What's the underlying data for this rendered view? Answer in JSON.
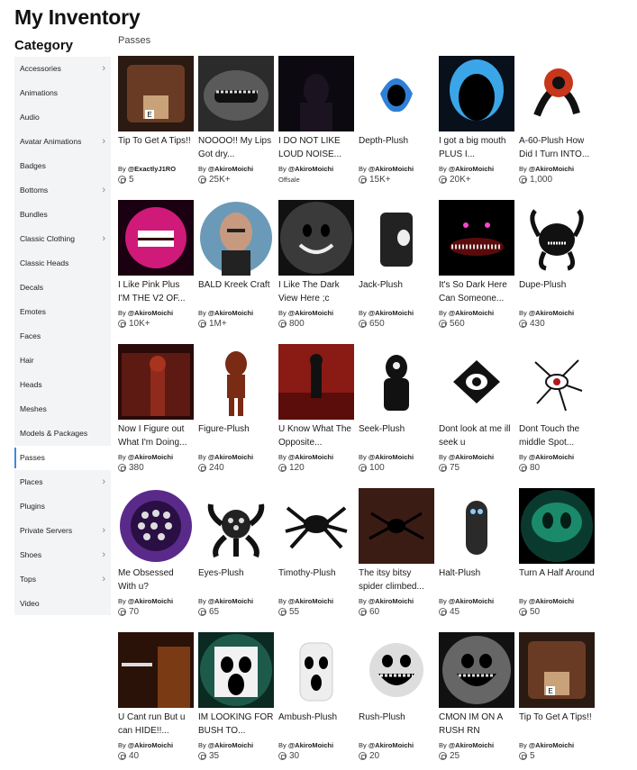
{
  "title": "My Inventory",
  "category_heading": "Category",
  "section": "Passes",
  "sidebar": [
    {
      "label": "Accessories",
      "chevron": true
    },
    {
      "label": "Animations",
      "chevron": false
    },
    {
      "label": "Audio",
      "chevron": false
    },
    {
      "label": "Avatar Animations",
      "chevron": true
    },
    {
      "label": "Badges",
      "chevron": false
    },
    {
      "label": "Bottoms",
      "chevron": true
    },
    {
      "label": "Bundles",
      "chevron": false
    },
    {
      "label": "Classic Clothing",
      "chevron": true
    },
    {
      "label": "Classic Heads",
      "chevron": false
    },
    {
      "label": "Decals",
      "chevron": false
    },
    {
      "label": "Emotes",
      "chevron": false
    },
    {
      "label": "Faces",
      "chevron": false
    },
    {
      "label": "Hair",
      "chevron": false
    },
    {
      "label": "Heads",
      "chevron": false
    },
    {
      "label": "Meshes",
      "chevron": false
    },
    {
      "label": "Models & Packages",
      "chevron": false
    },
    {
      "label": "Passes",
      "chevron": false,
      "active": true
    },
    {
      "label": "Places",
      "chevron": true
    },
    {
      "label": "Plugins",
      "chevron": false
    },
    {
      "label": "Private Servers",
      "chevron": true
    },
    {
      "label": "Shoes",
      "chevron": true
    },
    {
      "label": "Tops",
      "chevron": true
    },
    {
      "label": "Video",
      "chevron": false
    }
  ],
  "items": [
    {
      "name": "Tip To Get A Tips!!",
      "by": "@ExactlyJ1RO",
      "price": "5",
      "thumb": "tip-box-thumbnail",
      "accent": "#6a3b24"
    },
    {
      "name": "NOOOO!! My Lips Got dry...",
      "by": "@AkiroMoichi",
      "price": "25K+",
      "thumb": "grinning-mouth-thumbnail",
      "accent": "#5a5a5a"
    },
    {
      "name": "I DO NOT LIKE LOUD NOISE...",
      "by": "@AkiroMoichi",
      "price": "",
      "offsale": "Offsale",
      "thumb": "dark-silhouette-thumbnail",
      "accent": "#1b1420"
    },
    {
      "name": "Depth-Plush",
      "by": "@AkiroMoichi",
      "price": "15K+",
      "thumb": "blue-blob-thumbnail",
      "accent": "#2f7fd6"
    },
    {
      "name": "I got a big mouth PLUS I...",
      "by": "@AkiroMoichi",
      "price": "20K+",
      "thumb": "blue-mouth-thumbnail",
      "accent": "#3aa6e8"
    },
    {
      "name": "A-60-Plush How Did I Turn INTO...",
      "by": "@AkiroMoichi",
      "price": "1,000",
      "thumb": "a60-plush-thumbnail",
      "accent": "#c8361c"
    },
    {
      "name": "I Like Pink Plus I'M THE V2 OF...",
      "by": "@AkiroMoichi",
      "price": "10K+",
      "thumb": "pink-monster-thumbnail",
      "accent": "#d01a7a"
    },
    {
      "name": "BALD Kreek Craft",
      "by": "@AkiroMoichi",
      "price": "1M+",
      "thumb": "bald-man-thumbnail",
      "accent": "#c79a80"
    },
    {
      "name": "I Like The Dark View Here ;c",
      "by": "@AkiroMoichi",
      "price": "800",
      "thumb": "smile-face-thumbnail",
      "accent": "#3a3a3a"
    },
    {
      "name": "Jack-Plush",
      "by": "@AkiroMoichi",
      "price": "650",
      "thumb": "jack-plush-thumbnail",
      "accent": "#222222"
    },
    {
      "name": "It's So Dark Here Can Someone...",
      "by": "@AkiroMoichi",
      "price": "560",
      "thumb": "dark-teeth-thumbnail",
      "accent": "#5a0b0b"
    },
    {
      "name": "Dupe-Plush",
      "by": "@AkiroMoichi",
      "price": "430",
      "thumb": "dupe-plush-thumbnail",
      "accent": "#111111"
    },
    {
      "name": "Now I Figure out What I'm Doing...",
      "by": "@AkiroMoichi",
      "price": "380",
      "thumb": "figure-room-thumbnail",
      "accent": "#5c1a12"
    },
    {
      "name": "Figure-Plush",
      "by": "@AkiroMoichi",
      "price": "240",
      "thumb": "figure-plush-thumbnail",
      "accent": "#7a2b14"
    },
    {
      "name": "U Know What The Opposite...",
      "by": "@AkiroMoichi",
      "price": "120",
      "thumb": "opposite-room-thumbnail",
      "accent": "#8a1a14"
    },
    {
      "name": "Seek-Plush",
      "by": "@AkiroMoichi",
      "price": "100",
      "thumb": "seek-plush-thumbnail",
      "accent": "#111111"
    },
    {
      "name": "Dont look at me ill seek u",
      "by": "@AkiroMoichi",
      "price": "75",
      "thumb": "seek-eye-thumbnail",
      "accent": "#111111"
    },
    {
      "name": "Dont Touch the middle Spot...",
      "by": "@AkiroMoichi",
      "price": "80",
      "thumb": "cracked-eye-thumbnail",
      "accent": "#b01818"
    },
    {
      "name": "Me Obsessed With u?",
      "by": "@AkiroMoichi",
      "price": "70",
      "thumb": "many-eyes-thumbnail",
      "accent": "#5a2a8a"
    },
    {
      "name": "Eyes-Plush",
      "by": "@AkiroMoichi",
      "price": "65",
      "thumb": "eyes-plush-thumbnail",
      "accent": "#222222"
    },
    {
      "name": "Timothy-Plush",
      "by": "@AkiroMoichi",
      "price": "55",
      "thumb": "timothy-plush-thumbnail",
      "accent": "#111111"
    },
    {
      "name": "The itsy bitsy spider climbed...",
      "by": "@AkiroMoichi",
      "price": "60",
      "thumb": "spider-room-thumbnail",
      "accent": "#3a1c14"
    },
    {
      "name": "Halt-Plush",
      "by": "@AkiroMoichi",
      "price": "45",
      "thumb": "halt-plush-thumbnail",
      "accent": "#2a2a2a"
    },
    {
      "name": "Turn A Half Around",
      "by": "@AkiroMoichi",
      "price": "50",
      "thumb": "halt-green-thumbnail",
      "accent": "#1a8a6a"
    },
    {
      "name": "U Cant run But u can HIDE!!...",
      "by": "@AkiroMoichi",
      "price": "40",
      "thumb": "hide-room-thumbnail",
      "accent": "#7a3a14"
    },
    {
      "name": "IM LOOKING FOR BUSH TO...",
      "by": "@AkiroMoichi",
      "price": "35",
      "thumb": "ambush-face-thumbnail",
      "accent": "#1e5a4a"
    },
    {
      "name": "Ambush-Plush",
      "by": "@AkiroMoichi",
      "price": "30",
      "thumb": "ambush-plush-thumbnail",
      "accent": "#eeeeee"
    },
    {
      "name": "Rush-Plush",
      "by": "@AkiroMoichi",
      "price": "20",
      "thumb": "rush-plush-thumbnail",
      "accent": "#dddddd"
    },
    {
      "name": "CMON IM ON A RUSH RN",
      "by": "@AkiroMoichi",
      "price": "25",
      "thumb": "rush-face-thumbnail",
      "accent": "#666666"
    },
    {
      "name": "Tip To Get A Tips!!",
      "by": "@AkiroMoichi",
      "price": "5",
      "thumb": "tip-box-thumbnail",
      "accent": "#6a3b24"
    }
  ],
  "by_prefix": "By"
}
